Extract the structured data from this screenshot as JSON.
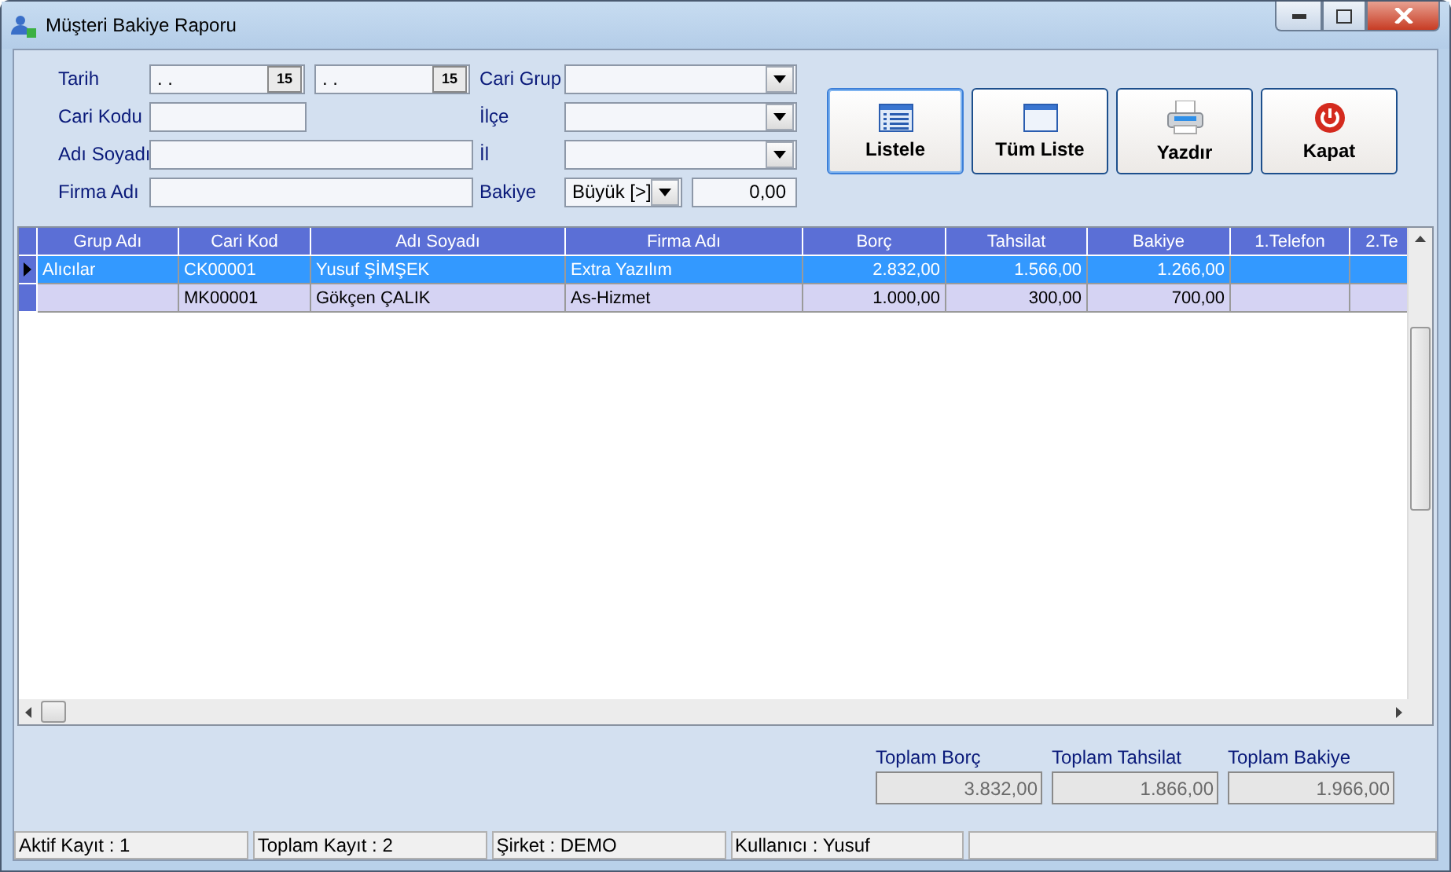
{
  "window": {
    "title": "Müşteri Bakiye Raporu"
  },
  "filters": {
    "left": [
      {
        "kind": "dates",
        "label": "Tarih",
        "values": [
          {
            "text": ". .",
            "calendar": "15"
          },
          {
            "text": ". .",
            "calendar": "15"
          }
        ]
      },
      {
        "kind": "code",
        "label": "Cari Kodu"
      },
      {
        "kind": "text",
        "label": "Adı Soyadı"
      },
      {
        "kind": "text",
        "label": "Firma Adı"
      }
    ],
    "right": [
      {
        "kind": "combo",
        "label": "Cari Grup"
      },
      {
        "kind": "combo",
        "label": "İlçe"
      },
      {
        "kind": "combo",
        "label": "İl"
      },
      {
        "kind": "compare",
        "label": "Bakiye",
        "operator": "Büyük [>]",
        "value": "0,00"
      }
    ]
  },
  "buttons": [
    {
      "kind": "list",
      "label": "Listele",
      "selected": true
    },
    {
      "kind": "window",
      "label": "Tüm Liste",
      "selected": false
    },
    {
      "kind": "print",
      "label": "Yazdır",
      "selected": false
    },
    {
      "kind": "power",
      "label": "Kapat",
      "selected": false
    }
  ],
  "table": {
    "columns": [
      "Grup Adı",
      "Cari Kod",
      "Adı Soyadı",
      "Firma Adı",
      "Borç",
      "Tahsilat",
      "Bakiye",
      "1.Telefon",
      "2.Te"
    ],
    "rows": [
      {
        "selected": true,
        "cells": [
          "Alıcılar",
          "CK00001",
          "Yusuf ŞİMŞEK",
          "Extra Yazılım",
          "2.832,00",
          "1.566,00",
          "1.266,00",
          "",
          ""
        ]
      },
      {
        "selected": false,
        "cells": [
          "",
          "MK00001",
          "Gökçen ÇALIK",
          "As-Hizmet",
          "1.000,00",
          "300,00",
          "700,00",
          "",
          ""
        ]
      }
    ]
  },
  "totals": [
    {
      "label": "Toplam Borç",
      "value": "3.832,00",
      "disabled": true
    },
    {
      "label": "Toplam Tahsilat",
      "value": "1.866,00",
      "disabled": true
    },
    {
      "label": "Toplam Bakiye",
      "value": "1.966,00",
      "disabled": true
    }
  ],
  "status_bar": [
    "Aktif Kayıt : 1",
    "Toplam Kayıt : 2",
    "Şirket : DEMO",
    "Kullanıcı : Yusuf"
  ]
}
